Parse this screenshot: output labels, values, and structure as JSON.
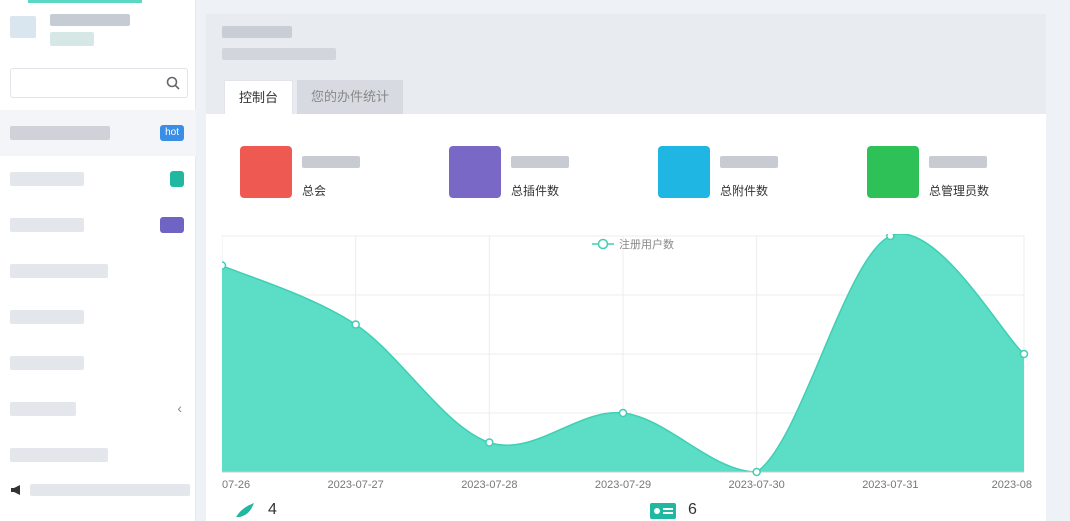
{
  "sidebar": {
    "search": {
      "placeholder": ""
    },
    "items": [
      {
        "badge": "hot"
      },
      {
        "badge": ""
      },
      {
        "badge": ""
      },
      {
        "badge": ""
      },
      {
        "badge": ""
      },
      {
        "badge": ""
      },
      {
        "badge": ""
      },
      {
        "badge": ""
      }
    ]
  },
  "tabs": [
    {
      "label": "控制台"
    },
    {
      "label": "您的办件统计"
    }
  ],
  "stats": [
    {
      "label": "总会",
      "color": "#ee5a52"
    },
    {
      "label": "总插件数",
      "color": "#7a68c6"
    },
    {
      "label": "总附件数",
      "color": "#1fb6e3"
    },
    {
      "label": "总管理员数",
      "color": "#2ec158"
    }
  ],
  "summary": [
    {
      "value": "4"
    },
    {
      "value": "6"
    }
  ],
  "chart_data": {
    "type": "area",
    "legend": "注册用户数",
    "x": [
      "07-26",
      "2023-07-27",
      "2023-07-28",
      "2023-07-29",
      "2023-07-30",
      "2023-07-31",
      "2023-08"
    ],
    "values": [
      3.5,
      2.5,
      0.5,
      1.0,
      0.0,
      4.0,
      2.0
    ],
    "ylim": [
      0,
      4
    ],
    "color": "#5cddc5",
    "grid": true,
    "legend_position": "top-center"
  }
}
